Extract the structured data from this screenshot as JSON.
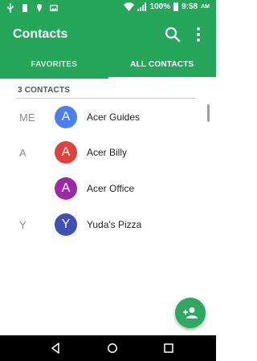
{
  "status_bar": {
    "battery_percent": "100%",
    "time": "9:58",
    "ampm": "AM"
  },
  "app_bar": {
    "title": "Contacts",
    "tabs": [
      {
        "label": "FAVORITES",
        "selected": false
      },
      {
        "label": "ALL CONTACTS",
        "selected": true
      }
    ]
  },
  "list": {
    "count_label": "3 CONTACTS",
    "contacts": [
      {
        "section": "ME",
        "initial": "A",
        "name": "Acer Guides",
        "color": "#4a7ff0"
      },
      {
        "section": "A",
        "initial": "A",
        "name": "Acer Billy",
        "color": "#e0423d"
      },
      {
        "section": "",
        "initial": "A",
        "name": "Acer Office",
        "color": "#9c2aa8"
      },
      {
        "section": "Y",
        "initial": "Y",
        "name": "Yuda's Pizza",
        "color": "#3f51b5"
      }
    ]
  },
  "colors": {
    "primary": "#26a65b",
    "fab": "#2eaa60"
  },
  "icons": {
    "search": "search-icon",
    "more": "more-vert-icon",
    "add_contact": "add-person-icon"
  }
}
